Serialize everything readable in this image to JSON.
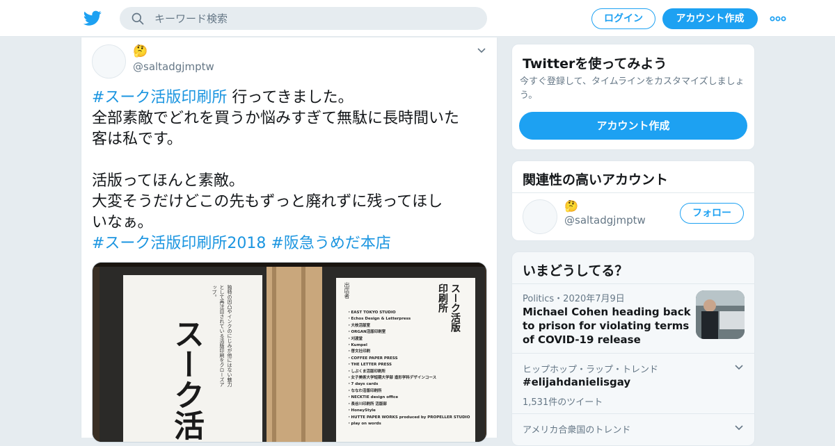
{
  "header": {
    "search_placeholder": "キーワード検索",
    "login_label": "ログイン",
    "signup_label": "アカウント作成"
  },
  "tweet": {
    "author_emoji": "🤔",
    "author_handle": "@saltadgjmptw",
    "lines": [
      {
        "hashtag": "#スーク活版印刷所",
        "text": " 行ってきました。"
      },
      {
        "hashtag": "",
        "text": "全部素敵でどれを買うか悩みすぎて無駄に長時間いた"
      },
      {
        "hashtag": "",
        "text": "客は私です。"
      },
      {
        "hashtag": "",
        "text": ""
      },
      {
        "hashtag": "",
        "text": "活版ってほんと素敵。"
      },
      {
        "hashtag": "",
        "text": "大変そうだけどこの先もずっと廃れずに残ってほし"
      },
      {
        "hashtag": "",
        "text": "いなぁ。"
      }
    ],
    "hashtags_line": [
      "#スーク活版印刷所2018",
      "#阪急うめだ本店"
    ],
    "photo": {
      "left_sign_title": "スーク活版印刷所",
      "left_sign_note": "独特の凹凸やインクのにじみが他にはない魅力として再注目されている活版印刷をクローズアップ。",
      "right_sign_title": "スーク活版印刷所",
      "right_sign_heading": "出店者",
      "exhibitors": [
        "・EAST TOKYO STUDIO",
        "・Echos Design & Letterpress",
        "・大枝活版室",
        "・ORGAN活版印刷室",
        "・刈渡堂",
        "・Kumpel",
        "・啓文社印刷",
        "・COFFEE PAPER PRESS",
        "・THE LETTER PRESS",
        "・しぶくま活版印刷所",
        "・女子美術大学短期大学部 造形学科デザインコース",
        "・7 days cards",
        "・ななわ活版印刷所",
        "・NECKTIE design office",
        "・長谷川印刷所 活版部",
        "・HoneyStyle",
        "・HUTTE PAPER WORKS produced by PROPELLER STUDIO",
        "・play on words"
      ]
    }
  },
  "promo": {
    "title": "Twitterを使ってみよう",
    "description": "今すぐ登録して、タイムラインをカスタマイズしましょう。",
    "cta_label": "アカウント作成"
  },
  "related": {
    "title": "関連性の高いアカウント",
    "emoji": "🤔",
    "handle": "@saltadgjmptw",
    "follow_label": "フォロー"
  },
  "trends": {
    "title": "いまどうしてる？",
    "items": [
      {
        "meta": "Politics・2020年7月9日",
        "headline": "Michael Cohen heading back to prison for violating terms of COVID-19 release"
      },
      {
        "meta": "ヒップホップ・ラップ・トレンド",
        "name": "#elijahdanielisgay",
        "count": "1,531件のツイート"
      },
      {
        "meta": "アメリカ合衆国のトレンド"
      }
    ]
  },
  "colors": {
    "brand": "#1da1f2",
    "hashtag": "#1b95e0",
    "background": "#e6ecf0"
  }
}
